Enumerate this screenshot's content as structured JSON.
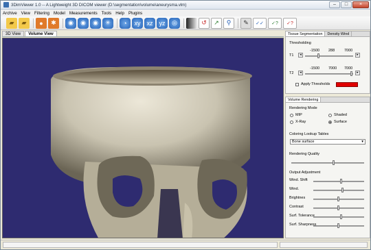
{
  "window": {
    "title": "3DimViewer 1.0 -- A Lightweight 3D DICOM viewer (D:\\segmentation\\volume\\aneurysma.vlm)"
  },
  "menu": [
    "Archive",
    "View",
    "Filtering",
    "Model",
    "Measurements",
    "Tools",
    "Help",
    "Plugins"
  ],
  "view_tabs": [
    "3D View",
    "Volume View"
  ],
  "tissue": {
    "tabs": [
      "Tissue Segmentation",
      "Density Wind"
    ],
    "section": "Thresholding",
    "t1": {
      "label": "T1",
      "min": "-1500",
      "value": "288",
      "max": "7000"
    },
    "t2": {
      "label": "T2",
      "min": "-1500",
      "value": "7000",
      "max": "7000"
    },
    "apply_label": "Apply Thresholds",
    "threshold_color": "#e00000"
  },
  "volume": {
    "tabs": [
      "Volume Rendering"
    ],
    "mode_label": "Rendering Mode",
    "modes": {
      "mip": "MIP",
      "shaded": "Shaded",
      "xray": "X-Ray",
      "surface": "Surface"
    },
    "lut_label": "Coloring Lookup Tables",
    "lut_value": "Bone surface",
    "quality_label": "Rendering Quality",
    "quality_level": 0.6,
    "output_label": "Output Adjustment",
    "sliders": [
      {
        "label": "Wind. Shift",
        "level": 0.55
      },
      {
        "label": "Wind.",
        "level": 0.58
      },
      {
        "label": "Brightnes",
        "level": 0.5
      },
      {
        "label": "Contrast",
        "level": 0.5
      },
      {
        "label": "Surf. Tolerance",
        "level": 0.55
      },
      {
        "label": "Surf. Sharpness",
        "level": 0.5
      }
    ]
  },
  "icons": [
    "open-folder-icon",
    "save-icon",
    "user-icon",
    "settings-icon",
    "view-icons",
    "gradient-icon",
    "undo-icon",
    "measure-icon",
    "search-icon",
    "check-icons"
  ]
}
